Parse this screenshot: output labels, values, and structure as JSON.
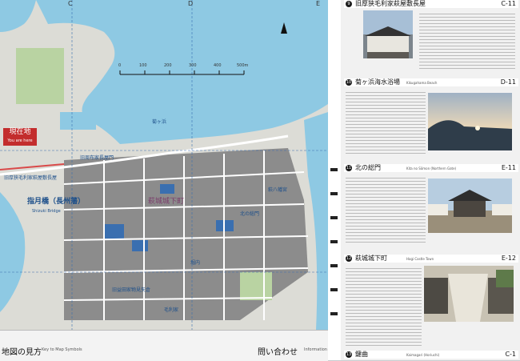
{
  "grid_columns": [
    "C",
    "D",
    "E"
  ],
  "scale_bar": {
    "ticks": [
      "0",
      "100",
      "200",
      "300",
      "400",
      "500m"
    ]
  },
  "you_are_here": {
    "label": "現在地",
    "label_en": "You are here"
  },
  "map_places": {
    "hagi_bridge": "指月橋（長州藩）",
    "hagi_bridge_en": "Shizuki Bridge",
    "castle_gate": "北の総門",
    "residences": [
      "旧厚狭毛利家萩屋敷長屋",
      "萩城城下町",
      "菊ヶ浜",
      "堀内",
      "萩八幡宮",
      "旧周布家長屋門",
      "旧益田家物見矢倉",
      "毛利家"
    ]
  },
  "legend": {
    "title": "地図の見方",
    "subtitle": "Key to Map Symbols"
  },
  "contact": {
    "title": "問い合わせ",
    "subtitle": "Information"
  },
  "entries": [
    {
      "num": "9",
      "title": "旧厚狭毛利家萩屋敷長屋",
      "en": "Former Asa Mōri Clan Residence",
      "code": "C-11"
    },
    {
      "num": "10",
      "title": "菊ヶ浜海水浴場",
      "en": "Kikugahama Beach",
      "code": "D-11"
    },
    {
      "num": "11",
      "title": "北の総門",
      "en": "Kita no Sōmon (Northern Gate)",
      "code": "E-11"
    },
    {
      "num": "12",
      "title": "萩城城下町",
      "en": "Hagi Castle Town",
      "code": "E-12"
    },
    {
      "num": "13",
      "title": "鍵曲",
      "en": "Kaimagari (Horiuchi)",
      "code": "C-1"
    }
  ],
  "colors": {
    "sea": "#8ec9e3",
    "land": "#dcdcd6",
    "town": "#8c8c8c",
    "accent": "#c32d2d",
    "road": "#ffffff"
  }
}
